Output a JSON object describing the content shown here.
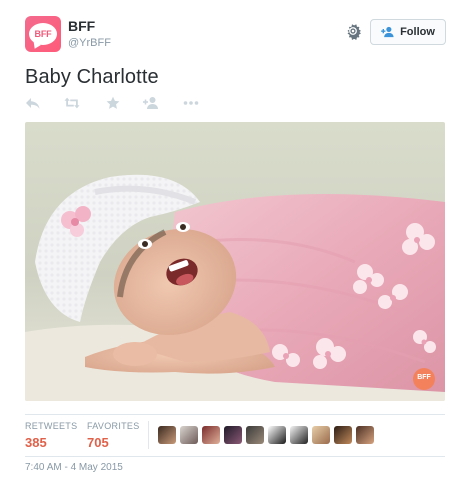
{
  "account": {
    "avatar_text": "BFF",
    "name": "BFF",
    "handle": "@YrBFF"
  },
  "header": {
    "follow_label": "Follow",
    "settings_icon": "gear-icon"
  },
  "tweet": {
    "text": "Baby Charlotte",
    "photo_watermark": "BFF"
  },
  "actions": [
    {
      "name": "reply-icon"
    },
    {
      "name": "retweet-icon"
    },
    {
      "name": "favorite-icon"
    },
    {
      "name": "follow-user-icon"
    },
    {
      "name": "more-icon"
    }
  ],
  "stats": {
    "retweets_label": "RETWEETS",
    "retweets_value": "385",
    "favorites_label": "FAVORITES",
    "favorites_value": "705"
  },
  "favoriters_count_shown": 10,
  "timestamp": "7:40 AM - 4 May 2015",
  "colors": {
    "accent": "#e0614a",
    "brand_pink": "#f36b8e",
    "muted": "#8899a6",
    "text": "#292f33"
  }
}
